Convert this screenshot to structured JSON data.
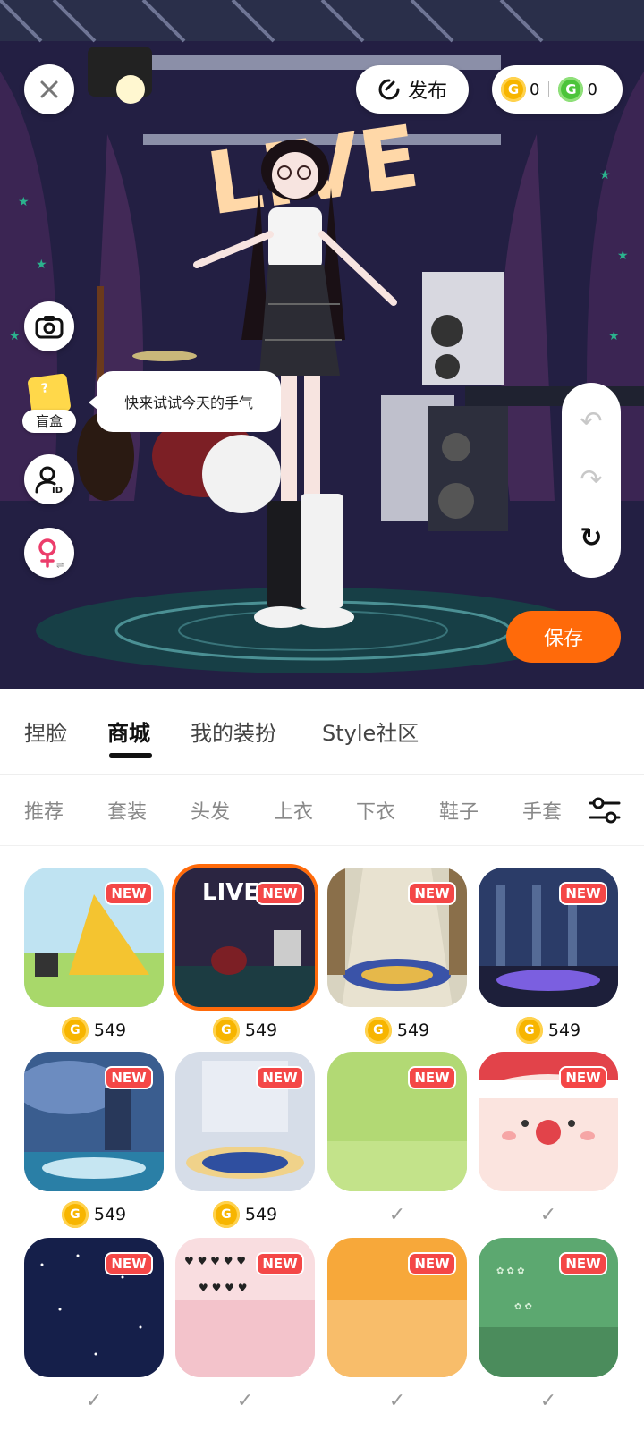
{
  "stage": {
    "publish_label": "发布",
    "coins_gold": "0",
    "coins_green": "0",
    "blindbox_label": "盲盒",
    "tip_text": "快来试试今天的手气",
    "save_label": "保存",
    "sign_text": "LIVE"
  },
  "main_tabs": [
    {
      "label": "捏脸"
    },
    {
      "label": "商城"
    },
    {
      "label": "我的装扮"
    },
    {
      "label": "Style社区"
    }
  ],
  "active_main_tab": "商城",
  "sub_tabs": [
    {
      "label": "推荐"
    },
    {
      "label": "套装"
    },
    {
      "label": "头发"
    },
    {
      "label": "上衣"
    },
    {
      "label": "下衣"
    },
    {
      "label": "鞋子"
    },
    {
      "label": "手套"
    }
  ],
  "badge_text": "NEW",
  "coin_glyph": "G",
  "items": [
    {
      "price": "549",
      "owned": false,
      "selected": false,
      "scene": "tent"
    },
    {
      "price": "549",
      "owned": false,
      "selected": true,
      "scene": "live"
    },
    {
      "price": "549",
      "owned": false,
      "selected": false,
      "scene": "hall"
    },
    {
      "price": "549",
      "owned": false,
      "selected": false,
      "scene": "palace"
    },
    {
      "price": "549",
      "owned": false,
      "selected": false,
      "scene": "stormy"
    },
    {
      "price": "549",
      "owned": false,
      "selected": false,
      "scene": "church"
    },
    {
      "price": "",
      "owned": true,
      "selected": false,
      "scene": "green"
    },
    {
      "price": "",
      "owned": true,
      "selected": false,
      "scene": "santa"
    },
    {
      "price": "",
      "owned": true,
      "selected": false,
      "scene": "night"
    },
    {
      "price": "",
      "owned": true,
      "selected": false,
      "scene": "hearts"
    },
    {
      "price": "",
      "owned": true,
      "selected": false,
      "scene": "orange"
    },
    {
      "price": "",
      "owned": true,
      "selected": false,
      "scene": "mint"
    }
  ],
  "colors": {
    "accent": "#ff6a0a",
    "badge": "#f44747",
    "coin_gold": "#f7b500",
    "coin_green": "#4cc43a"
  }
}
